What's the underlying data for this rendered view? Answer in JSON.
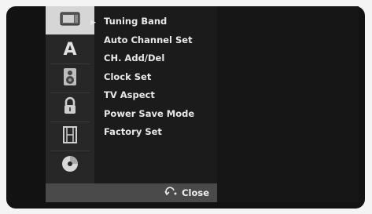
{
  "menu": {
    "icons": [
      {
        "name": "display-setup-icon",
        "selected": true
      },
      {
        "name": "language-icon",
        "glyph": "A"
      },
      {
        "name": "audio-speaker-icon"
      },
      {
        "name": "lock-icon"
      },
      {
        "name": "film-recording-icon"
      },
      {
        "name": "disc-icon"
      }
    ],
    "items": [
      "Tuning Band",
      "Auto Channel Set",
      "CH. Add/Del",
      "Clock Set",
      "TV Aspect",
      "Power Save Mode",
      "Factory Set"
    ]
  },
  "footer": {
    "close_label": "Close"
  }
}
